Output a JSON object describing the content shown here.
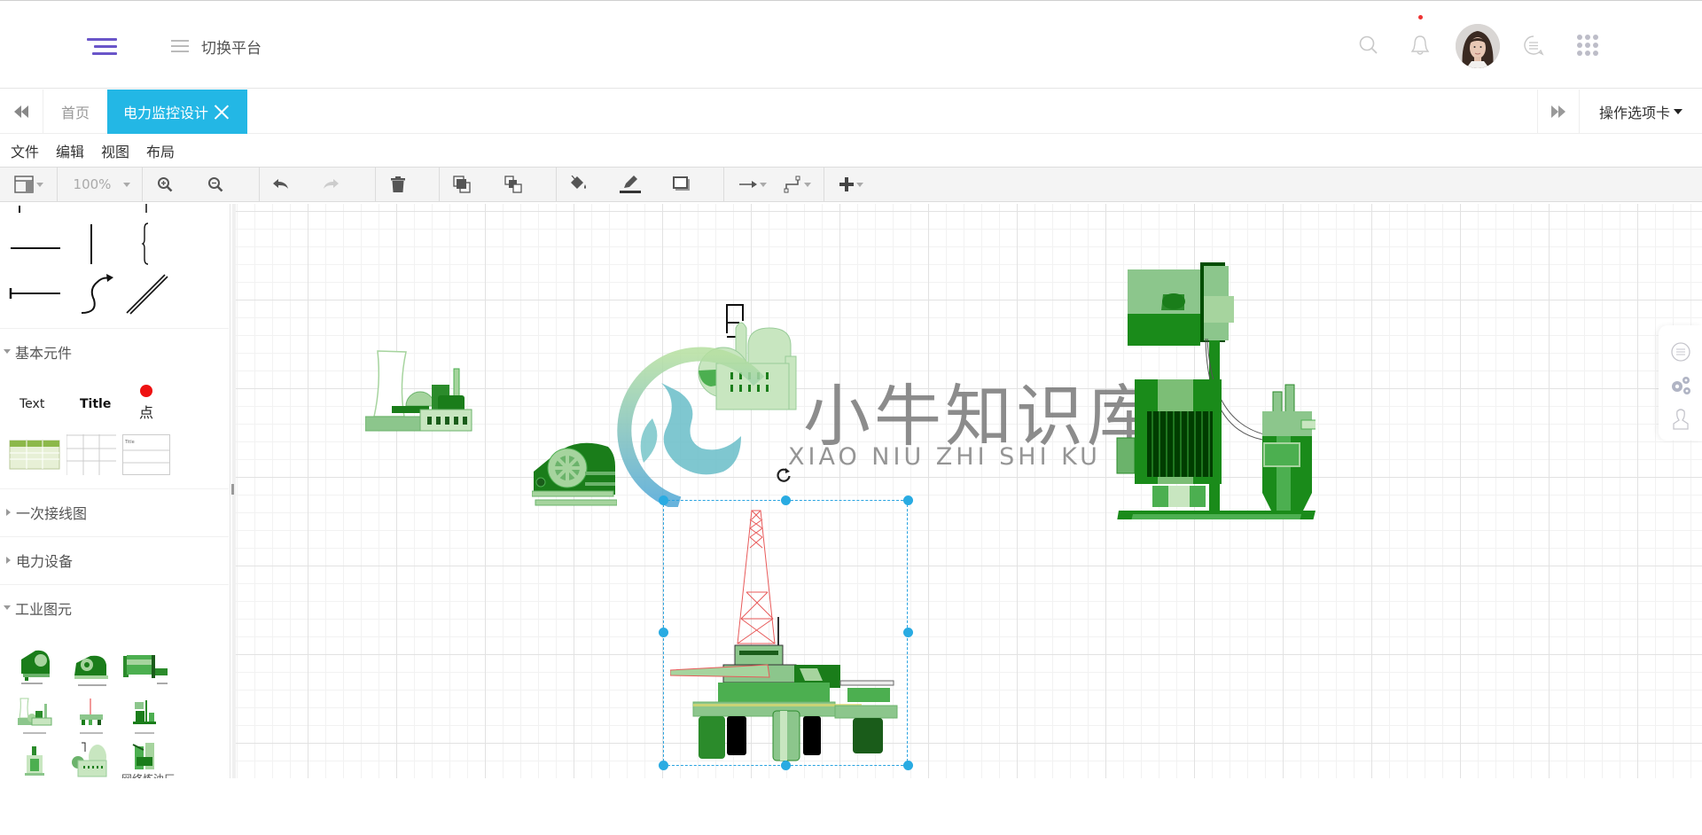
{
  "header": {
    "switch_platform_label": "切换平台",
    "icons": [
      "search-icon",
      "bell-icon",
      "avatar",
      "message-icon",
      "apps-grid-icon"
    ],
    "notification_dot_color": "#e33333",
    "accent_color": "#6a55c9"
  },
  "tabs": {
    "home_label": "首页",
    "active_label": "电力监控设计",
    "active_color": "#23b7e5",
    "operations_label": "操作选项卡"
  },
  "menubar": {
    "items": [
      "文件",
      "编辑",
      "视图",
      "布局"
    ]
  },
  "toolbar": {
    "zoom_value": "100%",
    "buttons": [
      "format-panel",
      "zoom",
      "zoom-in",
      "zoom-out",
      "undo",
      "redo",
      "delete",
      "to-front",
      "to-back",
      "fill-color",
      "line-color",
      "shadow",
      "connection",
      "waypoints",
      "insert"
    ]
  },
  "sidebar": {
    "sections": [
      {
        "label": "基本元件",
        "expanded": true
      },
      {
        "label": "一次接线图",
        "expanded": false
      },
      {
        "label": "电力设备",
        "expanded": false
      },
      {
        "label": "工业图元",
        "expanded": true
      }
    ],
    "basic": {
      "text_label": "Text",
      "title_label": "Title",
      "point_label": "点",
      "point_color": "#ee1111",
      "table_title_label": "Title"
    },
    "industrial_last_label": "网络炼油厂"
  },
  "canvas": {
    "selection_color": "#29abe2",
    "watermark_cn": "小牛知识库",
    "watermark_en": "XIAO NIU ZHI SHI KU",
    "shapes": [
      "nuclear-power-plant",
      "refinery-factory",
      "jaw-crusher",
      "offshore-oil-platform",
      "motor-pump-unit"
    ]
  },
  "float_tools": [
    "chat-icon",
    "settings-icon",
    "user-icon"
  ]
}
